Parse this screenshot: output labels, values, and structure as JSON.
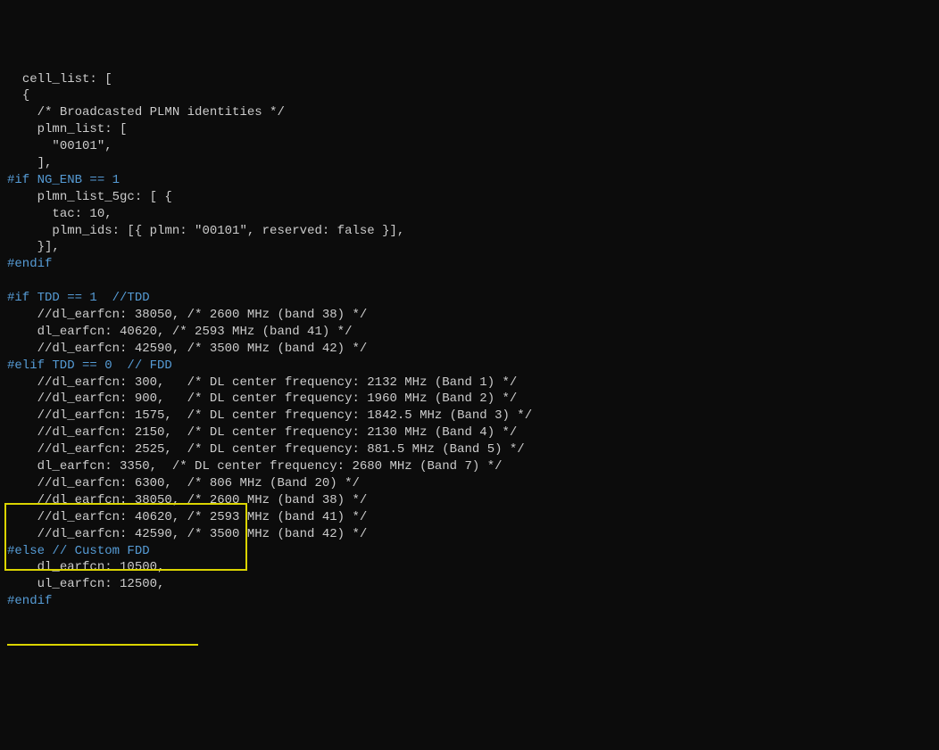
{
  "lines": [
    {
      "indent": "  ",
      "text": "cell_list: ["
    },
    {
      "indent": "  ",
      "text": "{"
    },
    {
      "indent": "    ",
      "text": "/* Broadcasted PLMN identities */"
    },
    {
      "indent": "    ",
      "text": "plmn_list: ["
    },
    {
      "indent": "      ",
      "text": "\"00101\","
    },
    {
      "indent": "    ",
      "text": "],"
    },
    {
      "keyword": "#if NG_ENB == 1"
    },
    {
      "indent": "    ",
      "text": "plmn_list_5gc: [ {"
    },
    {
      "indent": "      ",
      "text": "tac: 10,"
    },
    {
      "indent": "      ",
      "text": "plmn_ids: [{ plmn: \"00101\", reserved: false }],"
    },
    {
      "indent": "    ",
      "text": "}],"
    },
    {
      "keyword": "#endif"
    },
    {
      "blank": true
    },
    {
      "keyword": "#if TDD == 1  ",
      "kcomment": "//TDD"
    },
    {
      "indent": "    ",
      "text": "//dl_earfcn: 38050, /* 2600 MHz (band 38) */"
    },
    {
      "indent": "    ",
      "text": "dl_earfcn: 40620, /* 2593 MHz (band 41) */"
    },
    {
      "indent": "    ",
      "text": "//dl_earfcn: 42590, /* 3500 MHz (band 42) */"
    },
    {
      "keyword": "#elif TDD == 0  ",
      "kcomment": "// FDD"
    },
    {
      "indent": "    ",
      "text": "//dl_earfcn: 300,   /* DL center frequency: 2132 MHz (Band 1) */"
    },
    {
      "indent": "    ",
      "text": "//dl_earfcn: 900,   /* DL center frequency: 1960 MHz (Band 2) */"
    },
    {
      "indent": "    ",
      "text": "//dl_earfcn: 1575,  /* DL center frequency: 1842.5 MHz (Band 3) */"
    },
    {
      "indent": "    ",
      "text": "//dl_earfcn: 2150,  /* DL center frequency: 2130 MHz (Band 4) */"
    },
    {
      "indent": "    ",
      "text": "//dl_earfcn: 2525,  /* DL center frequency: 881.5 MHz (Band 5) */"
    },
    {
      "indent": "    ",
      "text": "dl_earfcn: 3350,  /* DL center frequency: 2680 MHz (Band 7) */"
    },
    {
      "indent": "    ",
      "text": "//dl_earfcn: 6300,  /* 806 MHz (Band 20) */"
    },
    {
      "indent": "    ",
      "text": "//dl_earfcn: 38050, /* 2600 MHz (band 38) */"
    },
    {
      "indent": "    ",
      "text": "//dl_earfcn: 40620, /* 2593 MHz (band 41) */"
    },
    {
      "indent": "    ",
      "text": "//dl_earfcn: 42590, /* 3500 MHz (band 42) */"
    },
    {
      "keyword": "#else ",
      "kcomment": "// Custom FDD"
    },
    {
      "indent": "    ",
      "text": "dl_earfcn: 10500,"
    },
    {
      "indent": "    ",
      "text": "ul_earfcn: 12500,"
    },
    {
      "keyword": "#endif"
    }
  ]
}
